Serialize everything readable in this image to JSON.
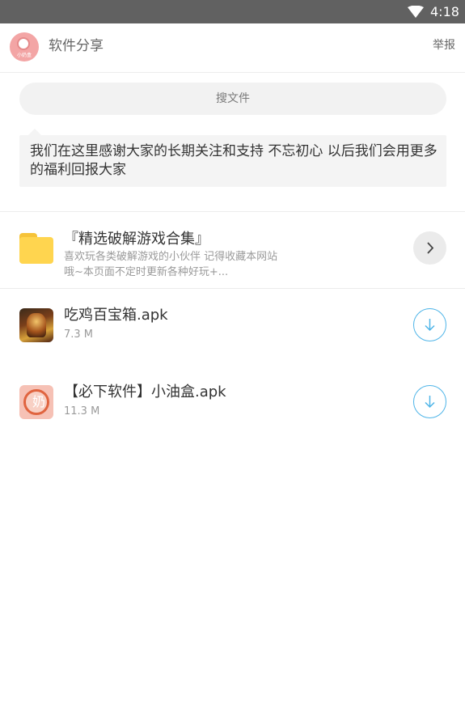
{
  "status_bar": {
    "time": "4:18"
  },
  "header": {
    "avatar_text": "小奶盒",
    "title": "软件分享",
    "report_label": "举报"
  },
  "search": {
    "label": "搜文件"
  },
  "notice": {
    "text": "我们在这里感谢大家的长期关注和支持 不忘初心 以后我们会用更多的福利回报大家"
  },
  "folder": {
    "title": "『精选破解游戏合集』",
    "desc_line1": "喜欢玩各类破解游戏的小伙伴 记得收藏本网站",
    "desc_line2": "哦~本页面不定时更新各种好玩+..."
  },
  "files": [
    {
      "name": "吃鸡百宝箱.apk",
      "size": "7.3 M"
    },
    {
      "name": "【必下软件】小油盒.apk",
      "size": "11.3 M"
    }
  ],
  "colors": {
    "accent": "#4fb5e8",
    "folder": "#ffd54f",
    "status_bar": "#616161"
  },
  "icons": [
    "wifi-icon",
    "folder-icon",
    "chevron-right-icon",
    "download-icon"
  ]
}
